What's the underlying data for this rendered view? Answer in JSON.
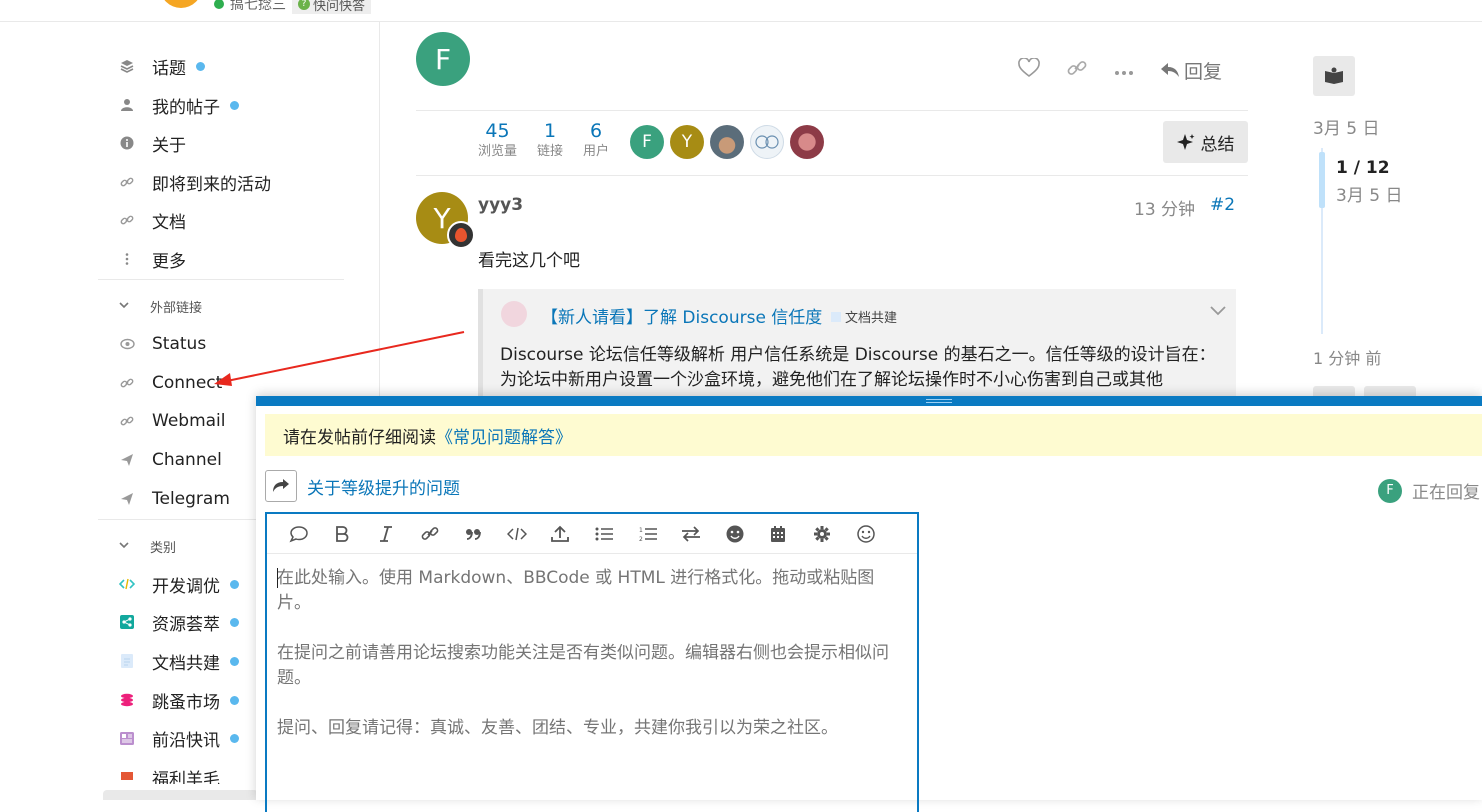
{
  "header": {
    "username": "搞七捻三",
    "badge": "快问快答"
  },
  "sidebar": {
    "items": [
      {
        "label": "话题",
        "icon": "layers-icon",
        "dot": true
      },
      {
        "label": "我的帖子",
        "icon": "user-icon",
        "dot": true
      },
      {
        "label": "关于",
        "icon": "info-icon",
        "dot": false
      },
      {
        "label": "即将到来的活动",
        "icon": "link-icon",
        "dot": false
      },
      {
        "label": "文档",
        "icon": "link-icon",
        "dot": false
      },
      {
        "label": "更多",
        "icon": "more-vertical-icon",
        "dot": false
      }
    ],
    "external_links_title": "外部链接",
    "external_links": [
      {
        "label": "Status",
        "icon": "eye-icon"
      },
      {
        "label": "Connect",
        "icon": "link-icon"
      },
      {
        "label": "Webmail",
        "icon": "link-icon"
      },
      {
        "label": "Channel",
        "icon": "send-icon"
      },
      {
        "label": "Telegram",
        "icon": "send-icon"
      }
    ],
    "categories_title": "类别",
    "categories": [
      {
        "label": "开发调优",
        "icon": "code-icon",
        "color": "#32c3c3"
      },
      {
        "label": "资源荟萃",
        "icon": "share-icon",
        "color": "#12a89d"
      },
      {
        "label": "文档共建",
        "icon": "document-icon",
        "color": "#dbeafa"
      },
      {
        "label": "跳蚤市场",
        "icon": "coins-icon",
        "color": "#ed207b"
      },
      {
        "label": "前沿快讯",
        "icon": "newspaper-icon",
        "color": "#bb8fce"
      },
      {
        "label": "福利羊毛",
        "icon": "gift-icon",
        "color": "#e45735"
      }
    ]
  },
  "topic": {
    "op_avatar_letter": "F",
    "reply_label": "回复",
    "stats": [
      {
        "num": "45",
        "label": "浏览量"
      },
      {
        "num": "1",
        "label": "链接"
      },
      {
        "num": "6",
        "label": "用户"
      }
    ],
    "participants": [
      {
        "letter": "F",
        "color": "#3aa17e"
      },
      {
        "letter": "Y",
        "color": "#a78c14"
      },
      {
        "letter": "",
        "color": "#6e7f8b"
      },
      {
        "letter": "",
        "color": "#e8eef3"
      },
      {
        "letter": "",
        "color": "#b05a63"
      }
    ],
    "summary_label": "总结"
  },
  "reply_post": {
    "avatar_letter": "Y",
    "username": "yyy3",
    "time": "13 分钟",
    "post_number": "#2",
    "body": "看完这几个吧",
    "onebox": {
      "title": "【新人请看】了解 Discourse 信任度",
      "category": "文档共建",
      "excerpt": "Discourse 论坛信任等级解析 用户信任系统是 Discourse 的基石之一。信任等级的设计旨在： 为论坛中新用户设置一个沙盒环境，避免他们在了解论坛操作时不小心伤害到自己或其他"
    }
  },
  "timeline": {
    "start_date": "3月 5 日",
    "position": "1 / 12",
    "position_date": "3月 5 日",
    "end_label": "1 分钟 前"
  },
  "composer": {
    "notice_prefix": "请在发帖前仔细阅读",
    "notice_link": "《常见问题解答》",
    "reply_to_title": "关于等级提升的问题",
    "replying_avatar": "F",
    "replying_label": "正在回复",
    "placeholder": "在此处输入。使用 Markdown、BBCode 或 HTML 进行格式化。拖动或粘贴图片。\n\n在提问之前请善用论坛搜索功能关注是否有类似问题。编辑器右侧也会提示相似问题。\n\n提问、回复请记得：真诚、友善、团结、专业，共建你我引以为荣之社区。",
    "toolbar": [
      "speech-bubble-icon",
      "bold-icon",
      "italic-icon",
      "link-icon",
      "quote-icon",
      "code-icon",
      "upload-icon",
      "bullet-list-icon",
      "numbered-list-icon",
      "swap-icon",
      "emoji-icon",
      "calendar-icon",
      "gear-icon",
      "smile-icon"
    ]
  },
  "accent_color": "#0a7ac2",
  "annotation_color": "#e8281e"
}
